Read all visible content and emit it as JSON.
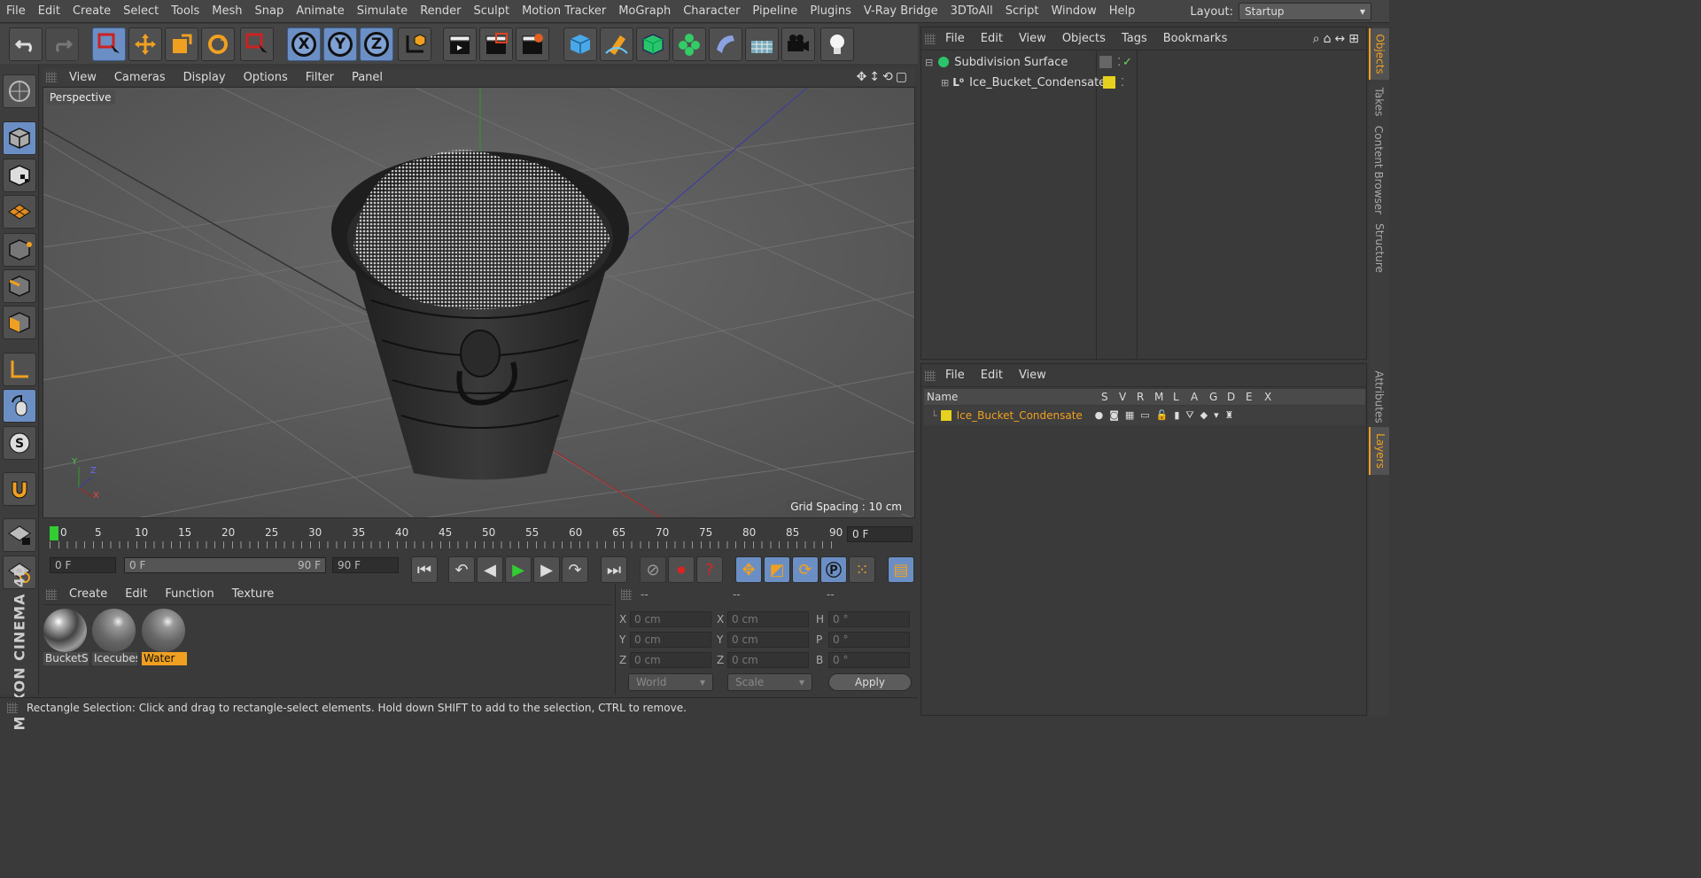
{
  "menubar": {
    "items": [
      "File",
      "Edit",
      "Create",
      "Select",
      "Tools",
      "Mesh",
      "Snap",
      "Animate",
      "Simulate",
      "Render",
      "Sculpt",
      "Motion Tracker",
      "MoGraph",
      "Character",
      "Pipeline",
      "Plugins",
      "V-Ray Bridge",
      "3DToAll",
      "Script",
      "Window",
      "Help"
    ],
    "layout_label": "Layout:",
    "layout_value": "Startup"
  },
  "toolbar": {
    "x_label": "X",
    "y_label": "Y",
    "z_label": "Z"
  },
  "viewport": {
    "menu": [
      "View",
      "Cameras",
      "Display",
      "Options",
      "Filter",
      "Panel"
    ],
    "label": "Perspective",
    "grid_spacing": "Grid Spacing : 10 cm",
    "axis_x": "X",
    "axis_y": "Y",
    "axis_z": "Z"
  },
  "timeline": {
    "ticks": [
      "0",
      "5",
      "10",
      "15",
      "20",
      "25",
      "30",
      "35",
      "40",
      "45",
      "50",
      "55",
      "60",
      "65",
      "70",
      "75",
      "80",
      "85",
      "90"
    ],
    "current_frame": "0 F"
  },
  "transport": {
    "start_field": "0 F",
    "range_start": "0 F",
    "range_end": "90 F",
    "end_field": "90 F"
  },
  "materials": {
    "menu": [
      "Create",
      "Edit",
      "Function",
      "Texture"
    ],
    "items": [
      {
        "name": "BucketS"
      },
      {
        "name": "Icecubes"
      },
      {
        "name": "Water"
      }
    ]
  },
  "coordinates": {
    "headers": [
      "--",
      "--",
      "--"
    ],
    "rows": [
      {
        "l1": "X",
        "v1": "0 cm",
        "l2": "X",
        "v2": "0 cm",
        "l3": "H",
        "v3": "0 °"
      },
      {
        "l1": "Y",
        "v1": "0 cm",
        "l2": "Y",
        "v2": "0 cm",
        "l3": "P",
        "v3": "0 °"
      },
      {
        "l1": "Z",
        "v1": "0 cm",
        "l2": "Z",
        "v2": "0 cm",
        "l3": "B",
        "v3": "0 °"
      }
    ],
    "world": "World",
    "scale": "Scale",
    "apply": "Apply"
  },
  "objects": {
    "menu": [
      "File",
      "Edit",
      "View",
      "Objects",
      "Tags",
      "Bookmarks"
    ],
    "items": [
      "Subdivision Surface",
      "Ice_Bucket_Condensate"
    ]
  },
  "layers": {
    "menu": [
      "File",
      "Edit",
      "View"
    ],
    "headers": [
      "Name",
      "S",
      "V",
      "R",
      "M",
      "L",
      "A",
      "G",
      "D",
      "E",
      "X"
    ],
    "items": [
      "Ice_Bucket_Condensate"
    ]
  },
  "right_tabs": [
    "Objects",
    "Takes",
    "Content Browser",
    "Structure",
    "Attributes",
    "Layers"
  ],
  "branding": "MAXON CINEMA 4D",
  "status": "Rectangle Selection: Click and drag to rectangle-select elements. Hold down SHIFT to add to the selection, CTRL to remove.",
  "colors": {
    "accent": "#f0a020",
    "tool_blue": "#6b8fc4",
    "layer_yellow": "#e6d21e"
  }
}
